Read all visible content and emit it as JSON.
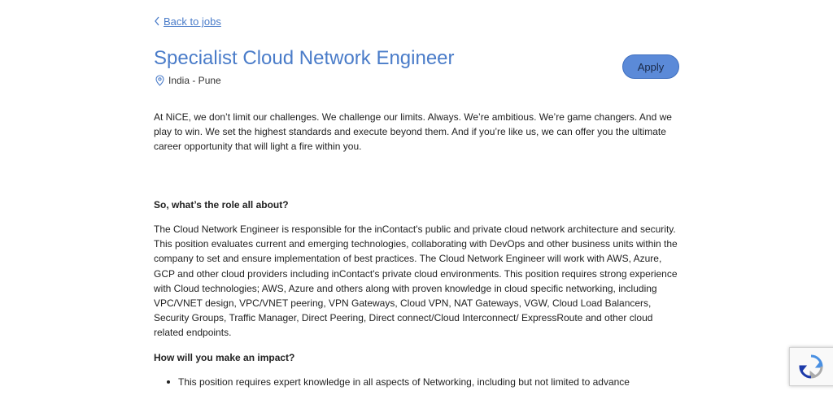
{
  "nav": {
    "back_label": "Back to jobs"
  },
  "job": {
    "title": "Specialist Cloud Network Engineer",
    "location": "India - Pune",
    "apply_label": "Apply"
  },
  "content": {
    "intro": "At NiCE, we don’t limit our challenges. We challenge our limits. Always. We’re ambitious. We’re game changers. And we play to win. We set the highest standards and execute beyond them. And if you’re like us, we can offer you the ultimate career opportunity that will light a fire within you.",
    "role_heading": "So, what’s the role all about?",
    "role_body": "The Cloud Network Engineer is responsible for the inContact's public and private cloud network architecture and security. This position evaluates current and emerging technologies, collaborating with DevOps and other business units within the company to set and ensure implementation of best practices.  The Cloud Network Engineer will work with AWS, Azure, GCP and other cloud providers including inContact's private cloud environments. This position requires strong experience with Cloud technologies; AWS, Azure and others along with proven knowledge in cloud specific networking, including VPC/VNET design, VPC/VNET peering, VPN Gateways, Cloud VPN, NAT Gateways, VGW, Cloud Load Balancers, Security Groups, Traffic Manager, Direct Peering, Direct connect/Cloud Interconnect/ ExpressRoute and other cloud related endpoints.",
    "impact_heading": "How will you make an impact?",
    "impact_items": [
      "This position requires expert knowledge in all aspects of Networking, including but not limited to advance"
    ]
  },
  "colors": {
    "link": "#4a7cc9",
    "button": "#5b8ad8"
  },
  "icons": {
    "back": "chevron-left-icon",
    "location": "location-pin-icon",
    "recaptcha": "recaptcha-icon"
  }
}
